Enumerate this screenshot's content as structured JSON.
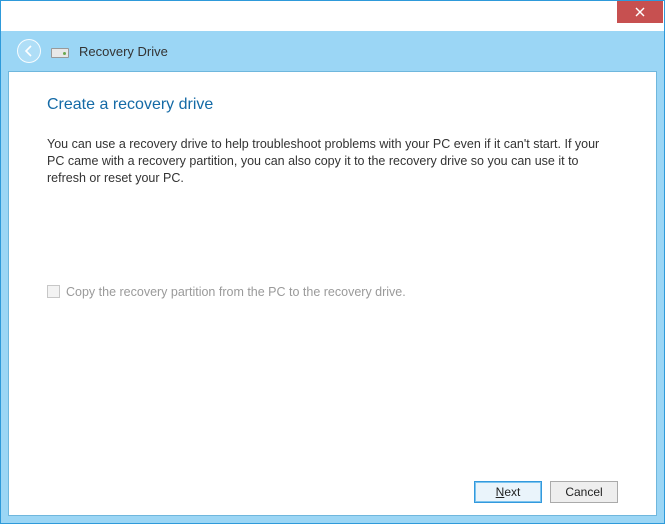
{
  "window": {
    "title": "Recovery Drive"
  },
  "page": {
    "heading": "Create a recovery drive",
    "body": "You can use a recovery drive to help troubleshoot problems with your PC even if it can't start. If your PC came with a recovery partition, you can also copy it to the recovery drive so you can use it to refresh or reset your PC."
  },
  "options": {
    "copy_partition_label": "Copy the recovery partition from the PC to the recovery drive.",
    "copy_partition_checked": false,
    "copy_partition_enabled": false
  },
  "buttons": {
    "next": "Next",
    "cancel": "Cancel"
  }
}
